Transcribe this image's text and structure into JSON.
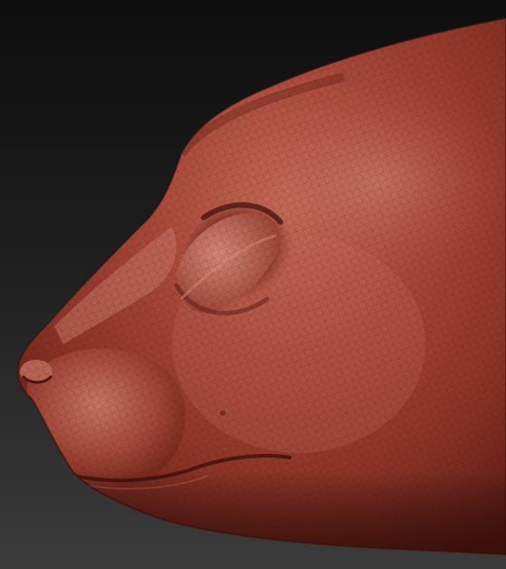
{
  "scene": {
    "subject": "sculpted-animal-head-side-view",
    "material_color": "#9a3b2c",
    "material_highlight": "#c8705e",
    "material_shadow": "#4a1610",
    "background_top": "#0f0f0f",
    "background_bottom": "#3a3a3a",
    "wireframe_visible": true
  }
}
